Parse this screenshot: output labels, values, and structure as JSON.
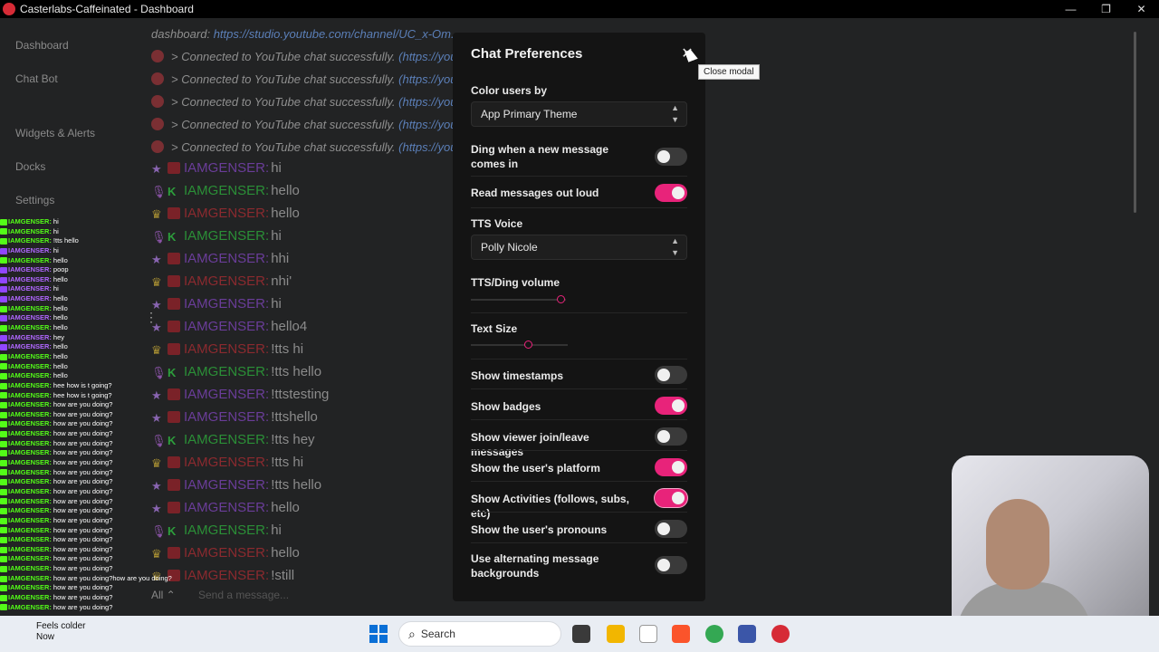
{
  "window": {
    "title": "Casterlabs-Caffeinated - Dashboard",
    "minimize": "—",
    "restore": "❐",
    "close": "✕"
  },
  "sidebar": {
    "items": [
      "Dashboard",
      "Chat Bot",
      "Widgets & Alerts",
      "Docks",
      "Settings"
    ]
  },
  "chat": {
    "header_prefix": "dashboard:",
    "header_link": "https://studio.youtube.com/channel/UC_x-Om...",
    "notices": [
      {
        "text": "> Connected to YouTube chat successfully.",
        "link": "(https://you"
      },
      {
        "text": "> Connected to YouTube chat successfully.",
        "link": "(https://you"
      },
      {
        "text": "> Connected to YouTube chat successfully.",
        "link": "(https://you"
      },
      {
        "text": "> Connected to YouTube chat successfully.",
        "link": "(https://you"
      },
      {
        "text": "> Connected to YouTube chat successfully.",
        "link": "(https://you"
      }
    ],
    "messages": [
      {
        "user": "IAMGENSER:",
        "text": "hi",
        "platform": "tw"
      },
      {
        "user": "IAMGENSER:",
        "text": "hello",
        "platform": "kick"
      },
      {
        "user": "IAMGENSER:",
        "text": "hello",
        "platform": "yt"
      },
      {
        "user": "IAMGENSER:",
        "text": "hi",
        "platform": "kick"
      },
      {
        "user": "IAMGENSER:",
        "text": "hhi",
        "platform": "tw"
      },
      {
        "user": "IAMGENSER:",
        "text": "nhi'",
        "platform": "yt"
      },
      {
        "user": "IAMGENSER:",
        "text": "hi",
        "platform": "tw"
      },
      {
        "user": "IAMGENSER:",
        "text": "hello4",
        "platform": "tw"
      },
      {
        "user": "IAMGENSER:",
        "text": "!tts hi",
        "platform": "yt"
      },
      {
        "user": "IAMGENSER:",
        "text": "!tts hello",
        "platform": "kick"
      },
      {
        "user": "IAMGENSER:",
        "text": "!ttstesting",
        "platform": "tw"
      },
      {
        "user": "IAMGENSER:",
        "text": "!ttshello",
        "platform": "tw"
      },
      {
        "user": "IAMGENSER:",
        "text": "!tts hey",
        "platform": "kick"
      },
      {
        "user": "IAMGENSER:",
        "text": "!tts hi",
        "platform": "yt"
      },
      {
        "user": "IAMGENSER:",
        "text": "!tts hello",
        "platform": "tw"
      },
      {
        "user": "IAMGENSER:",
        "text": "hello",
        "platform": "tw"
      },
      {
        "user": "IAMGENSER:",
        "text": "hi",
        "platform": "kick"
      },
      {
        "user": "IAMGENSER:",
        "text": "hello",
        "platform": "yt"
      },
      {
        "user": "IAMGENSER:",
        "text": "!still",
        "platform": "yt"
      }
    ],
    "platform_select": "All ⌃",
    "input_placeholder": "Send a message..."
  },
  "overlay_feed": [
    {
      "user": "IAMGENSER:",
      "text": "hi",
      "p": "k"
    },
    {
      "user": "IAMGENSER:",
      "text": "hi",
      "p": "k"
    },
    {
      "user": "IAMGENSER:",
      "text": "!tts hello",
      "p": "k"
    },
    {
      "user": "IAMGENSER:",
      "text": "hi",
      "p": "t"
    },
    {
      "user": "IAMGENSER:",
      "text": "hello",
      "p": "k"
    },
    {
      "user": "IAMGENSER:",
      "text": "poop",
      "p": "t"
    },
    {
      "user": "IAMGENSER:",
      "text": "hello",
      "p": "t"
    },
    {
      "user": "IAMGENSER:",
      "text": "hi",
      "p": "t"
    },
    {
      "user": "IAMGENSER:",
      "text": "hello",
      "p": "t"
    },
    {
      "user": "IAMGENSER:",
      "text": "hello",
      "p": "k"
    },
    {
      "user": "IAMGENSER:",
      "text": "hello",
      "p": "t"
    },
    {
      "user": "IAMGENSER:",
      "text": "hello",
      "p": "k"
    },
    {
      "user": "IAMGENSER:",
      "text": "hey",
      "p": "t"
    },
    {
      "user": "IAMGENSER:",
      "text": "hello",
      "p": "t"
    },
    {
      "user": "IAMGENSER:",
      "text": "hello",
      "p": "k"
    },
    {
      "user": "IAMGENSER:",
      "text": "hello",
      "p": "k"
    },
    {
      "user": "IAMGENSER:",
      "text": "hello",
      "p": "k"
    },
    {
      "user": "IAMGENSER:",
      "text": "hee how is t going?",
      "p": "k"
    },
    {
      "user": "IAMGENSER:",
      "text": "hee how is t going?",
      "p": "k"
    },
    {
      "user": "IAMGENSER:",
      "text": "how are you doing?",
      "p": "k"
    },
    {
      "user": "IAMGENSER:",
      "text": "how are you doing?",
      "p": "k"
    },
    {
      "user": "IAMGENSER:",
      "text": "how are you doing?",
      "p": "k"
    },
    {
      "user": "IAMGENSER:",
      "text": "how are you doing?",
      "p": "k"
    },
    {
      "user": "IAMGENSER:",
      "text": "how are you doing?",
      "p": "k"
    },
    {
      "user": "IAMGENSER:",
      "text": "how are you doing?",
      "p": "k"
    },
    {
      "user": "IAMGENSER:",
      "text": "how are you doing?",
      "p": "k"
    },
    {
      "user": "IAMGENSER:",
      "text": "how are you doing?",
      "p": "k"
    },
    {
      "user": "IAMGENSER:",
      "text": "how are you doing?",
      "p": "k"
    },
    {
      "user": "IAMGENSER:",
      "text": "how are you doing?",
      "p": "k"
    },
    {
      "user": "IAMGENSER:",
      "text": "how are you doing?",
      "p": "k"
    },
    {
      "user": "IAMGENSER:",
      "text": "how are you doing?",
      "p": "k"
    },
    {
      "user": "IAMGENSER:",
      "text": "how are you doing?",
      "p": "k"
    },
    {
      "user": "IAMGENSER:",
      "text": "how are you doing?",
      "p": "k"
    },
    {
      "user": "IAMGENSER:",
      "text": "how are you doing?",
      "p": "k"
    },
    {
      "user": "IAMGENSER:",
      "text": "how are you doing?",
      "p": "k"
    },
    {
      "user": "IAMGENSER:",
      "text": "how are you doing?",
      "p": "k"
    },
    {
      "user": "IAMGENSER:",
      "text": "how are you doing?",
      "p": "k"
    },
    {
      "user": "IAMGENSER:",
      "text": "how are you doing?how are you doing?",
      "p": "k"
    },
    {
      "user": "IAMGENSER:",
      "text": "how are you doing?",
      "p": "k"
    },
    {
      "user": "IAMGENSER:",
      "text": "how are you doing?",
      "p": "k"
    },
    {
      "user": "IAMGENSER:",
      "text": "how are you doing?",
      "p": "k"
    }
  ],
  "modal": {
    "title": "Chat Preferences",
    "close_icon": "✕",
    "tooltip": "Close modal",
    "color_users_label": "Color users by",
    "color_users_value": "App Primary Theme",
    "tts_voice_label": "TTS Voice",
    "tts_voice_value": "Polly Nicole",
    "volume_label": "TTS/Ding volume",
    "volume_level": 0.74,
    "text_size_label": "Text Size",
    "text_size_level": 0.6,
    "toggles": [
      {
        "label": "Ding when a new message comes in",
        "on": false
      },
      {
        "label": "Read messages out loud",
        "on": true
      },
      {
        "label": "Show timestamps",
        "on": false
      },
      {
        "label": "Show badges",
        "on": true
      },
      {
        "label": "Show viewer join/leave messages",
        "on": false
      },
      {
        "label": "Show the user's platform",
        "on": true
      },
      {
        "label": "Show Activities (follows, subs, etc)",
        "on": true
      },
      {
        "label": "Show the user's pronouns",
        "on": false
      },
      {
        "label": "Use alternating message backgrounds",
        "on": false
      }
    ],
    "accent": "#e8237a"
  },
  "taskbar": {
    "notif_title": "Feels colder",
    "notif_sub": "Now",
    "search_label": "Search",
    "search_icon": "🔍"
  }
}
